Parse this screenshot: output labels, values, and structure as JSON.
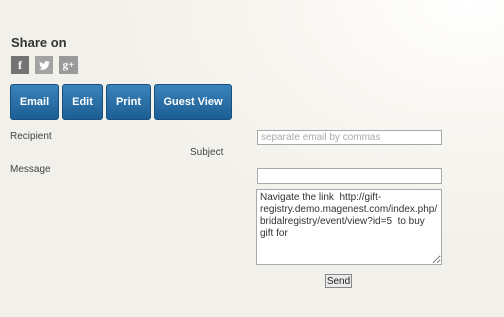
{
  "share": {
    "title": "Share on",
    "icons": [
      {
        "name": "facebook-icon",
        "glyph": "f"
      },
      {
        "name": "twitter-icon",
        "glyph": "t"
      },
      {
        "name": "google-plus-icon",
        "glyph": "g+"
      }
    ]
  },
  "actions": {
    "email": "Email",
    "edit": "Edit",
    "print": "Print",
    "guest_view": "Guest View"
  },
  "form": {
    "recipient_label": "Recipient",
    "recipient_placeholder": "separate email by commas",
    "recipient_value": "",
    "subject_label": "Subject",
    "subject_value": "",
    "message_label": "Message",
    "message_value": "Navigate the link  http://gift-registry.demo.magenest.com/index.php/bridalregistry/event/view?id=5  to buy gift for",
    "send_label": "Send"
  },
  "colors": {
    "button_primary": "#2a70a8",
    "button_text": "#ffffff"
  }
}
